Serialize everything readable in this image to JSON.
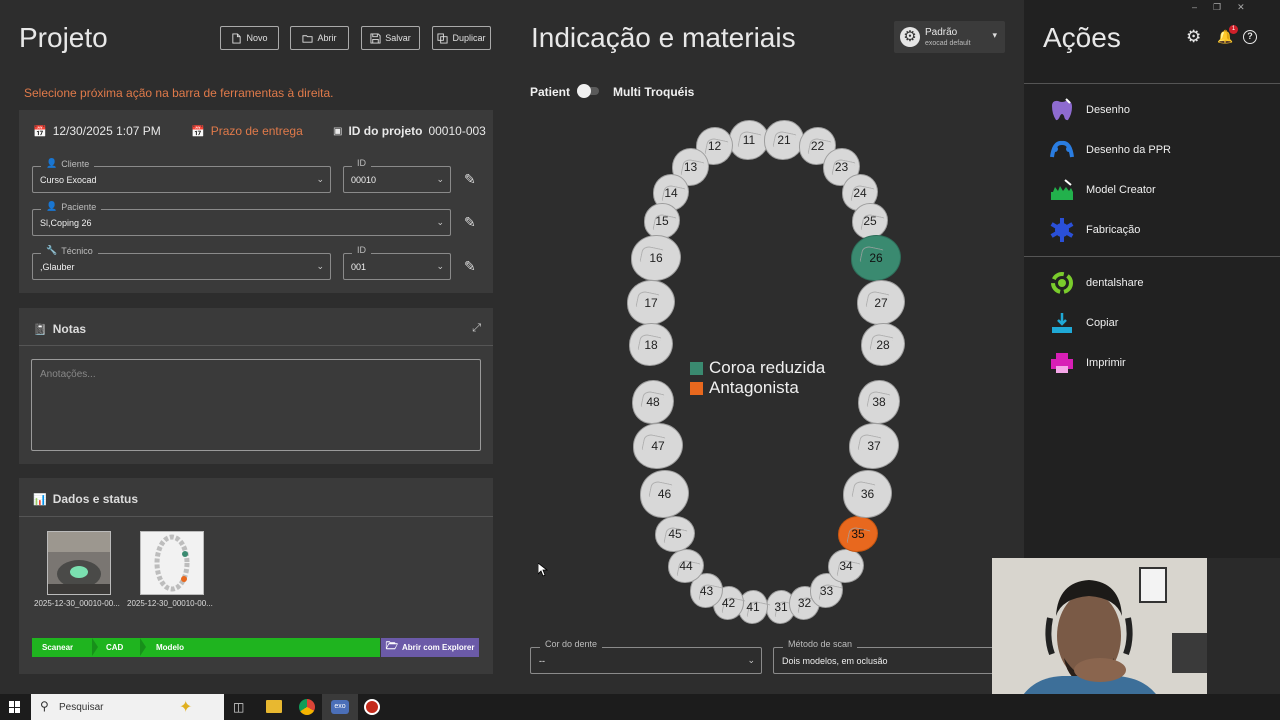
{
  "project": {
    "title": "Projeto",
    "buttons": {
      "new": "Novo",
      "open": "Abrir",
      "save": "Salvar",
      "duplicate": "Duplicar"
    },
    "hint": "Selecione próxima ação na barra de ferramentas à direita.",
    "date": "12/30/2025 1:07 PM",
    "deadline": "Prazo de entrega",
    "project_id_label": "ID do projeto",
    "project_id": "00010-003",
    "client_label": "Cliente",
    "client_value": "Curso Exocad",
    "client_id_label": "ID",
    "client_id_value": "00010",
    "patient_label": "Paciente",
    "patient_value": "Sl,Coping 26",
    "tech_label": "Técnico",
    "tech_value": ",Glauber",
    "tech_id_label": "ID",
    "tech_id_value": "001"
  },
  "notes": {
    "title": "Notas",
    "placeholder": "Anotações..."
  },
  "status": {
    "title": "Dados e status",
    "files": [
      "2025-12-30_00010-00...",
      "2025-12-30_00010-00..."
    ],
    "steps": [
      "Scanear",
      "CAD",
      "Modelo"
    ],
    "explorer": "Abrir com Explorer"
  },
  "indication": {
    "title": "Indicação e materiais",
    "profile_name": "Padrão",
    "profile_sub": "exocad default",
    "patient_toggle": "Patient",
    "multi_dies": "Multi Troquéis",
    "legend": [
      {
        "label": "Coroa reduzida",
        "color": "#3a8a70"
      },
      {
        "label": "Antagonista",
        "color": "#e8681e"
      }
    ],
    "teeth": [
      "11",
      "12",
      "13",
      "14",
      "15",
      "16",
      "17",
      "18",
      "21",
      "22",
      "23",
      "24",
      "25",
      "26",
      "27",
      "28",
      "31",
      "32",
      "33",
      "34",
      "35",
      "36",
      "37",
      "38",
      "41",
      "42",
      "43",
      "44",
      "45",
      "46",
      "47",
      "48"
    ],
    "tooth_color_label": "Cor do dente",
    "tooth_color_value": "--",
    "scan_method_label": "Método de scan",
    "scan_method_value": "Dois modelos, em oclusão"
  },
  "actions": {
    "title": "Ações",
    "notification_count": "1",
    "items": [
      "Desenho",
      "Desenho da PPR",
      "Model Creator",
      "Fabricação",
      "dentalshare",
      "Copiar",
      "Imprimir"
    ]
  },
  "taskbar": {
    "search_placeholder": "Pesquisar"
  },
  "colors": {
    "accent_orange": "#e07a4a",
    "step_green": "#1fb41f",
    "explorer_purple": "#6b5aa8"
  }
}
